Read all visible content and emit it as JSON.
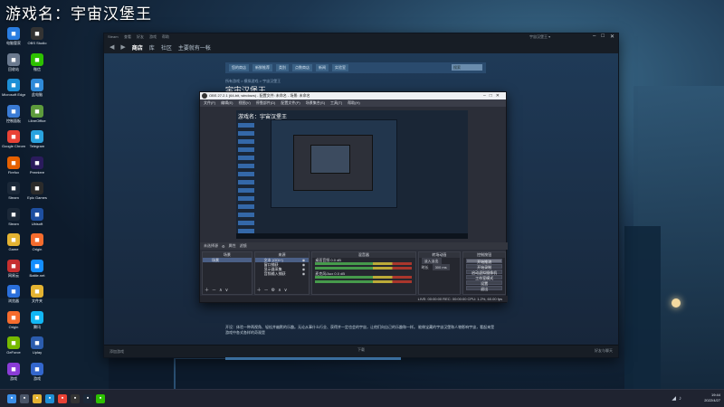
{
  "stream_title": "游戏名：宇宙汉堡王",
  "colors": {
    "steam_bg": "#1b2838",
    "obs_bg": "#2b2e38",
    "taskbar": "#1f2330",
    "accent_blue": "#3b78c4"
  },
  "desktop_icons": [
    {
      "label": "电脑管家",
      "icon": "shield-icon",
      "color": "#2a7de1"
    },
    {
      "label": "OBS Studio",
      "icon": "obs-icon",
      "color": "#333333"
    },
    {
      "label": "回收站",
      "icon": "recycle-bin-icon",
      "color": "#6b7a8f"
    },
    {
      "label": "微信",
      "icon": "wechat-icon",
      "color": "#2dc100"
    },
    {
      "label": "Microsoft Edge",
      "icon": "edge-icon",
      "color": "#1d8fd6"
    },
    {
      "label": "此电脑",
      "icon": "computer-icon",
      "color": "#2f8ad8"
    },
    {
      "label": "控制面板",
      "icon": "control-panel-icon",
      "color": "#3a7bd5"
    },
    {
      "label": "LibreOffice",
      "icon": "document-icon",
      "color": "#5d9b3c"
    },
    {
      "label": "Google Chrome",
      "icon": "chrome-icon",
      "color": "#e94235"
    },
    {
      "label": "Telegram",
      "icon": "telegram-icon",
      "color": "#2aa3df"
    },
    {
      "label": "Firefox",
      "icon": "firefox-icon",
      "color": "#e66000"
    },
    {
      "label": "Premiere",
      "icon": "premiere-icon",
      "color": "#2a1b5c"
    },
    {
      "label": "Steam",
      "icon": "steam-icon",
      "color": "#1b2838"
    },
    {
      "label": "Epic Games",
      "icon": "epic-icon",
      "color": "#2b2b2b"
    },
    {
      "label": "Steam",
      "icon": "steam-icon",
      "color": "#1b2838"
    },
    {
      "label": "Ubisoft",
      "icon": "ubisoft-icon",
      "color": "#1e4fa0"
    },
    {
      "label": "Game",
      "icon": "folder-icon",
      "color": "#e4b332"
    },
    {
      "label": "Origin",
      "icon": "origin-icon",
      "color": "#f56c2d"
    },
    {
      "label": "网易云",
      "icon": "music-icon",
      "color": "#c62f2f"
    },
    {
      "label": "Battle.net",
      "icon": "battlenet-icon",
      "color": "#148eff"
    },
    {
      "label": "浏览器",
      "icon": "browser-icon",
      "color": "#2a6fdb"
    },
    {
      "label": "文件夹",
      "icon": "folder-icon",
      "color": "#e4b332"
    },
    {
      "label": "Origin",
      "icon": "origin-icon",
      "color": "#f56c2d"
    },
    {
      "label": "腾讯",
      "icon": "qq-icon",
      "color": "#12b7f5"
    },
    {
      "label": "GeForce",
      "icon": "nvidia-icon",
      "color": "#76b900"
    },
    {
      "label": "Uplay",
      "icon": "uplay-icon",
      "color": "#2b5cad"
    },
    {
      "label": "游戏",
      "icon": "gamepad-icon",
      "color": "#8a3cd6"
    },
    {
      "label": "游戏",
      "icon": "gamepad-icon",
      "color": "#3366cc"
    }
  ],
  "steam": {
    "menu_items": [
      "Steam",
      "查看",
      "好友",
      "游戏",
      "帮助"
    ],
    "user": "宇宙汉堡王 ▾",
    "nav": {
      "store": "商店",
      "library": "库",
      "community": "社区",
      "username": "主要就有一帐"
    },
    "store_header": [
      "您的商店",
      "新鲜推荐",
      "类别",
      "点数商店",
      "新闻",
      "实验室"
    ],
    "search_placeholder": "搜索",
    "breadcrumb": "所有游戏 > 模拟游戏 > 宇宙汉堡王",
    "game_title": "宇宙汉堡王",
    "description": "开设：体验一种两视角、轻松并幽默的乐趣。无论从事什么行业、获得并一定也会的宇宙，让他们向自己的乐趣和一样。 能做宝藏的宇宙汉堡和人物影响宇宙，看起来是游戏中各式各样的奇观是",
    "bottom_left": "添加游戏",
    "bottom_center": "下载",
    "bottom_right": "好友与聊天"
  },
  "obs": {
    "title": "OBS 27.2.1 (64-bit, windows) - 配置文件: 未命名 - 场景: 未命名",
    "menu": [
      "文件(F)",
      "编辑(E)",
      "视图(V)",
      "停靠部件(D)",
      "配置文件(P)",
      "场景集合(S)",
      "工具(T)",
      "帮助(H)"
    ],
    "preview_text": "游戏名：宇宙汉堡王",
    "status_strip": [
      "未选择源",
      "属性",
      "滤镜"
    ],
    "scenes": {
      "header": "场景",
      "items": [
        "场景"
      ]
    },
    "sources": {
      "header": "来源",
      "items": [
        "文本 (GDI+)",
        "窗口捕获",
        "显示器采集",
        "音频输入捕获"
      ]
    },
    "mixer": {
      "header": "混音器",
      "channels": [
        "桌面音频",
        "麦克风/Aux"
      ],
      "db_values": [
        "0.0 dB",
        "0.0 dB"
      ]
    },
    "transitions": {
      "header": "转场动画",
      "type": "淡入淡出",
      "duration_label": "时长",
      "duration": "300 ms"
    },
    "controls": {
      "header": "控制按钮",
      "buttons": [
        "开始推流",
        "开始录制",
        "启动虚拟摄像机",
        "工作室模式",
        "设置",
        "退出"
      ]
    },
    "footer": "LIVE: 00:00:00  REC: 00:00:00  CPU: 1.2%, 60.00 fps"
  },
  "taskbar": {
    "apps": [
      {
        "icon": "windows-start-icon",
        "color": "#3b8ee8"
      },
      {
        "icon": "search-icon",
        "color": "#4a5568"
      },
      {
        "icon": "file-explorer-icon",
        "color": "#e4b332"
      },
      {
        "icon": "edge-icon",
        "color": "#1d8fd6"
      },
      {
        "icon": "chrome-icon",
        "color": "#e94235"
      },
      {
        "icon": "obs-icon",
        "color": "#333333"
      },
      {
        "icon": "steam-icon",
        "color": "#1b2838"
      },
      {
        "icon": "wechat-icon",
        "color": "#2dc100"
      }
    ],
    "time": "19:44",
    "date": "2022/4/27"
  }
}
